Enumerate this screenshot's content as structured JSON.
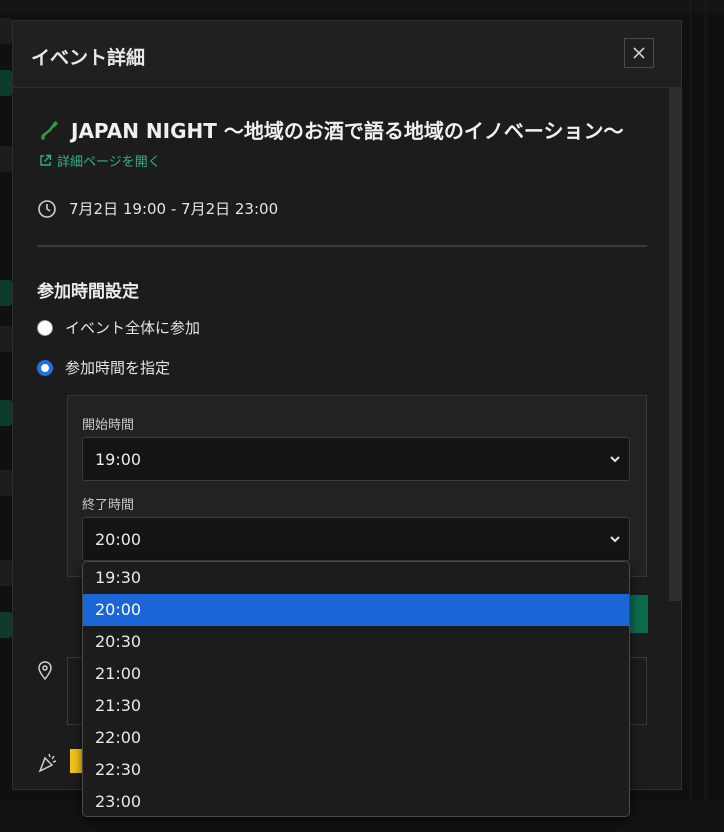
{
  "modal": {
    "title": "イベント詳細",
    "close_icon": "close-icon"
  },
  "event": {
    "icon": "japan-map-icon",
    "title": "JAPAN NIGHT ～地域のお酒で語る地域のイノベーション～",
    "detail_link": "詳細ページを開く",
    "time_range": "7月2日 19:00 - 7月2日 23:00"
  },
  "participation": {
    "section_title": "参加時間設定",
    "options": [
      {
        "label": "イベント全体に参加",
        "selected": false
      },
      {
        "label": "参加時間を指定",
        "selected": true
      }
    ],
    "start": {
      "label": "開始時間",
      "value": "19:00"
    },
    "end": {
      "label": "終了時間",
      "value": "20:00"
    }
  },
  "dropdown": {
    "options": [
      "19:30",
      "20:00",
      "20:30",
      "21:00",
      "21:30",
      "22:00",
      "22:30",
      "23:00"
    ],
    "selected": "20:00"
  },
  "colors": {
    "accent_blue": "#1a66d6",
    "link_green": "#2bb28a",
    "badge_yellow": "#f0c419"
  }
}
